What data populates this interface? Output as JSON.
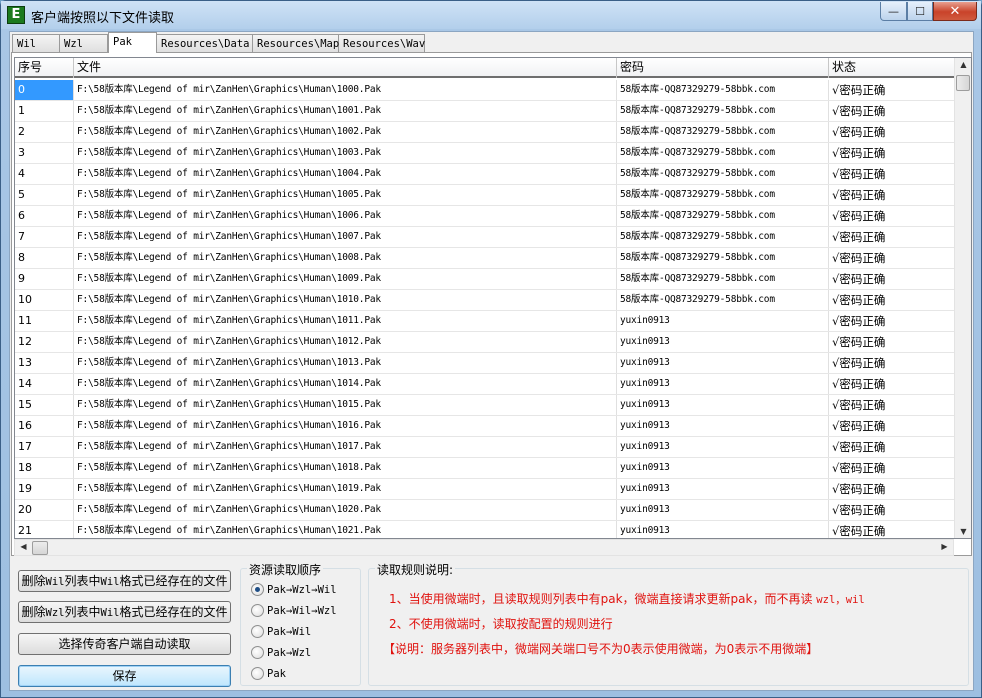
{
  "window": {
    "icon_letter": "E",
    "title": "客户端按照以下文件读取",
    "min_glyph": "—",
    "max_glyph": "☐",
    "close_glyph": "✕"
  },
  "tabs": [
    "Wil",
    "Wzl",
    "Pak",
    "Resources\\Data",
    "Resources\\Map",
    "Resources\\Wav"
  ],
  "active_tab": "Pak",
  "table": {
    "columns": [
      "序号",
      "文件",
      "密码",
      "状态"
    ],
    "rows": [
      [
        "0",
        "F:\\58版本库\\Legend of mir\\ZanHen\\Graphics\\Human\\1000.Pak",
        "58版本库-QQ87329279-58bbk.com",
        "√密码正确"
      ],
      [
        "1",
        "F:\\58版本库\\Legend of mir\\ZanHen\\Graphics\\Human\\1001.Pak",
        "58版本库-QQ87329279-58bbk.com",
        "√密码正确"
      ],
      [
        "2",
        "F:\\58版本库\\Legend of mir\\ZanHen\\Graphics\\Human\\1002.Pak",
        "58版本库-QQ87329279-58bbk.com",
        "√密码正确"
      ],
      [
        "3",
        "F:\\58版本库\\Legend of mir\\ZanHen\\Graphics\\Human\\1003.Pak",
        "58版本库-QQ87329279-58bbk.com",
        "√密码正确"
      ],
      [
        "4",
        "F:\\58版本库\\Legend of mir\\ZanHen\\Graphics\\Human\\1004.Pak",
        "58版本库-QQ87329279-58bbk.com",
        "√密码正确"
      ],
      [
        "5",
        "F:\\58版本库\\Legend of mir\\ZanHen\\Graphics\\Human\\1005.Pak",
        "58版本库-QQ87329279-58bbk.com",
        "√密码正确"
      ],
      [
        "6",
        "F:\\58版本库\\Legend of mir\\ZanHen\\Graphics\\Human\\1006.Pak",
        "58版本库-QQ87329279-58bbk.com",
        "√密码正确"
      ],
      [
        "7",
        "F:\\58版本库\\Legend of mir\\ZanHen\\Graphics\\Human\\1007.Pak",
        "58版本库-QQ87329279-58bbk.com",
        "√密码正确"
      ],
      [
        "8",
        "F:\\58版本库\\Legend of mir\\ZanHen\\Graphics\\Human\\1008.Pak",
        "58版本库-QQ87329279-58bbk.com",
        "√密码正确"
      ],
      [
        "9",
        "F:\\58版本库\\Legend of mir\\ZanHen\\Graphics\\Human\\1009.Pak",
        "58版本库-QQ87329279-58bbk.com",
        "√密码正确"
      ],
      [
        "10",
        "F:\\58版本库\\Legend of mir\\ZanHen\\Graphics\\Human\\1010.Pak",
        "58版本库-QQ87329279-58bbk.com",
        "√密码正确"
      ],
      [
        "11",
        "F:\\58版本库\\Legend of mir\\ZanHen\\Graphics\\Human\\1011.Pak",
        "yuxin0913",
        "√密码正确"
      ],
      [
        "12",
        "F:\\58版本库\\Legend of mir\\ZanHen\\Graphics\\Human\\1012.Pak",
        "yuxin0913",
        "√密码正确"
      ],
      [
        "13",
        "F:\\58版本库\\Legend of mir\\ZanHen\\Graphics\\Human\\1013.Pak",
        "yuxin0913",
        "√密码正确"
      ],
      [
        "14",
        "F:\\58版本库\\Legend of mir\\ZanHen\\Graphics\\Human\\1014.Pak",
        "yuxin0913",
        "√密码正确"
      ],
      [
        "15",
        "F:\\58版本库\\Legend of mir\\ZanHen\\Graphics\\Human\\1015.Pak",
        "yuxin0913",
        "√密码正确"
      ],
      [
        "16",
        "F:\\58版本库\\Legend of mir\\ZanHen\\Graphics\\Human\\1016.Pak",
        "yuxin0913",
        "√密码正确"
      ],
      [
        "17",
        "F:\\58版本库\\Legend of mir\\ZanHen\\Graphics\\Human\\1017.Pak",
        "yuxin0913",
        "√密码正确"
      ],
      [
        "18",
        "F:\\58版本库\\Legend of mir\\ZanHen\\Graphics\\Human\\1018.Pak",
        "yuxin0913",
        "√密码正确"
      ],
      [
        "19",
        "F:\\58版本库\\Legend of mir\\ZanHen\\Graphics\\Human\\1019.Pak",
        "yuxin0913",
        "√密码正确"
      ],
      [
        "20",
        "F:\\58版本库\\Legend of mir\\ZanHen\\Graphics\\Human\\1020.Pak",
        "yuxin0913",
        "√密码正确"
      ],
      [
        "21",
        "F:\\58版本库\\Legend of mir\\ZanHen\\Graphics\\Human\\1021.Pak",
        "yuxin0913",
        "√密码正确"
      ]
    ],
    "selected_row": "0"
  },
  "buttons": {
    "delete_wil": {
      "pre": "删除",
      "code1": "Wil",
      "mid": "列表中",
      "code2": "Wil",
      "post": "格式已经存在的文件"
    },
    "delete_wzl": {
      "pre": "删除",
      "code1": "Wzl",
      "mid": "列表中",
      "code2": "Wil",
      "post": "格式已经存在的文件"
    },
    "select_client": "选择传奇客户端自动读取",
    "save": "保存"
  },
  "read_order": {
    "label": "资源读取顺序",
    "options": [
      "Pak→Wzl→Wil",
      "Pak→Wil→Wzl",
      "Pak→Wil",
      "Pak→Wzl",
      "Pak"
    ],
    "selected": "Pak→Wzl→Wil"
  },
  "rules": {
    "label": "读取规则说明:",
    "line1": {
      "text": "1、当使用微端时，且读取规则列表中有pak，微端直接请求更新pak，而不再读 ",
      "code": "wzl，wil"
    },
    "line2": "2、不使用微端时，读取按配置的规则进行",
    "line3": "【说明：服务器列表中，微端网关端口号不为0表示使用微端，为0表示不用微端】"
  },
  "icons": {
    "scroll_up": "▲",
    "scroll_down": "▼",
    "scroll_left": "◀",
    "scroll_right": "▶"
  },
  "colors": {
    "selection": "#3399ff",
    "rule_text": "#e0120e",
    "close_button": "#c9432a",
    "app_icon": "#1c7a1e"
  }
}
